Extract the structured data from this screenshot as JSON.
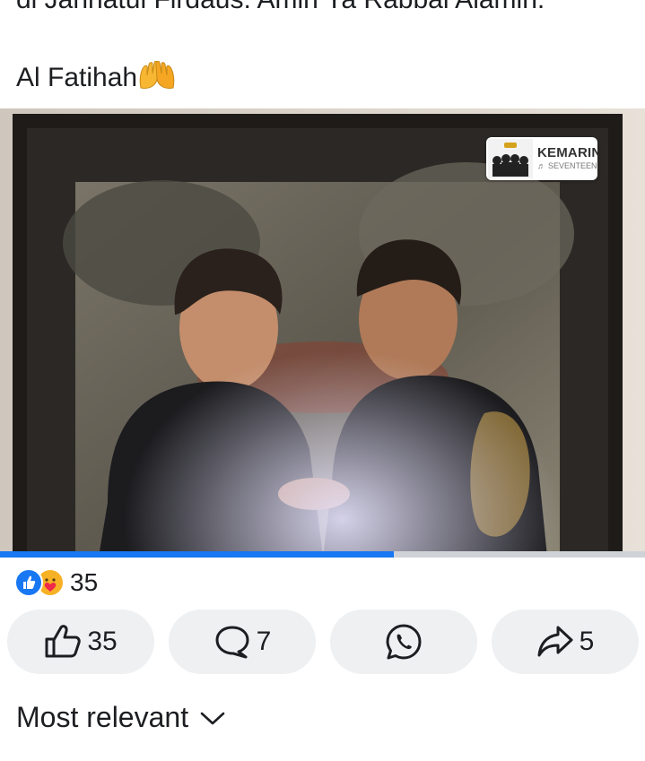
{
  "post": {
    "line1": "di Jannatul Firdaus. Amin Ya Rabbal Alamin.",
    "line2": "Al Fatihah"
  },
  "music": {
    "title": "KEMARIN",
    "artist": "SEVENTEEN"
  },
  "video": {
    "progress": 0.61
  },
  "reactions": {
    "count": "35",
    "icons": [
      "like-icon",
      "care-icon"
    ]
  },
  "actions": {
    "like_count": "35",
    "comment_count": "7",
    "share_count": "5"
  },
  "comments": {
    "sort_label": "Most relevant"
  },
  "colors": {
    "accent": "#1877f2",
    "button_bg": "#eef0f2"
  }
}
